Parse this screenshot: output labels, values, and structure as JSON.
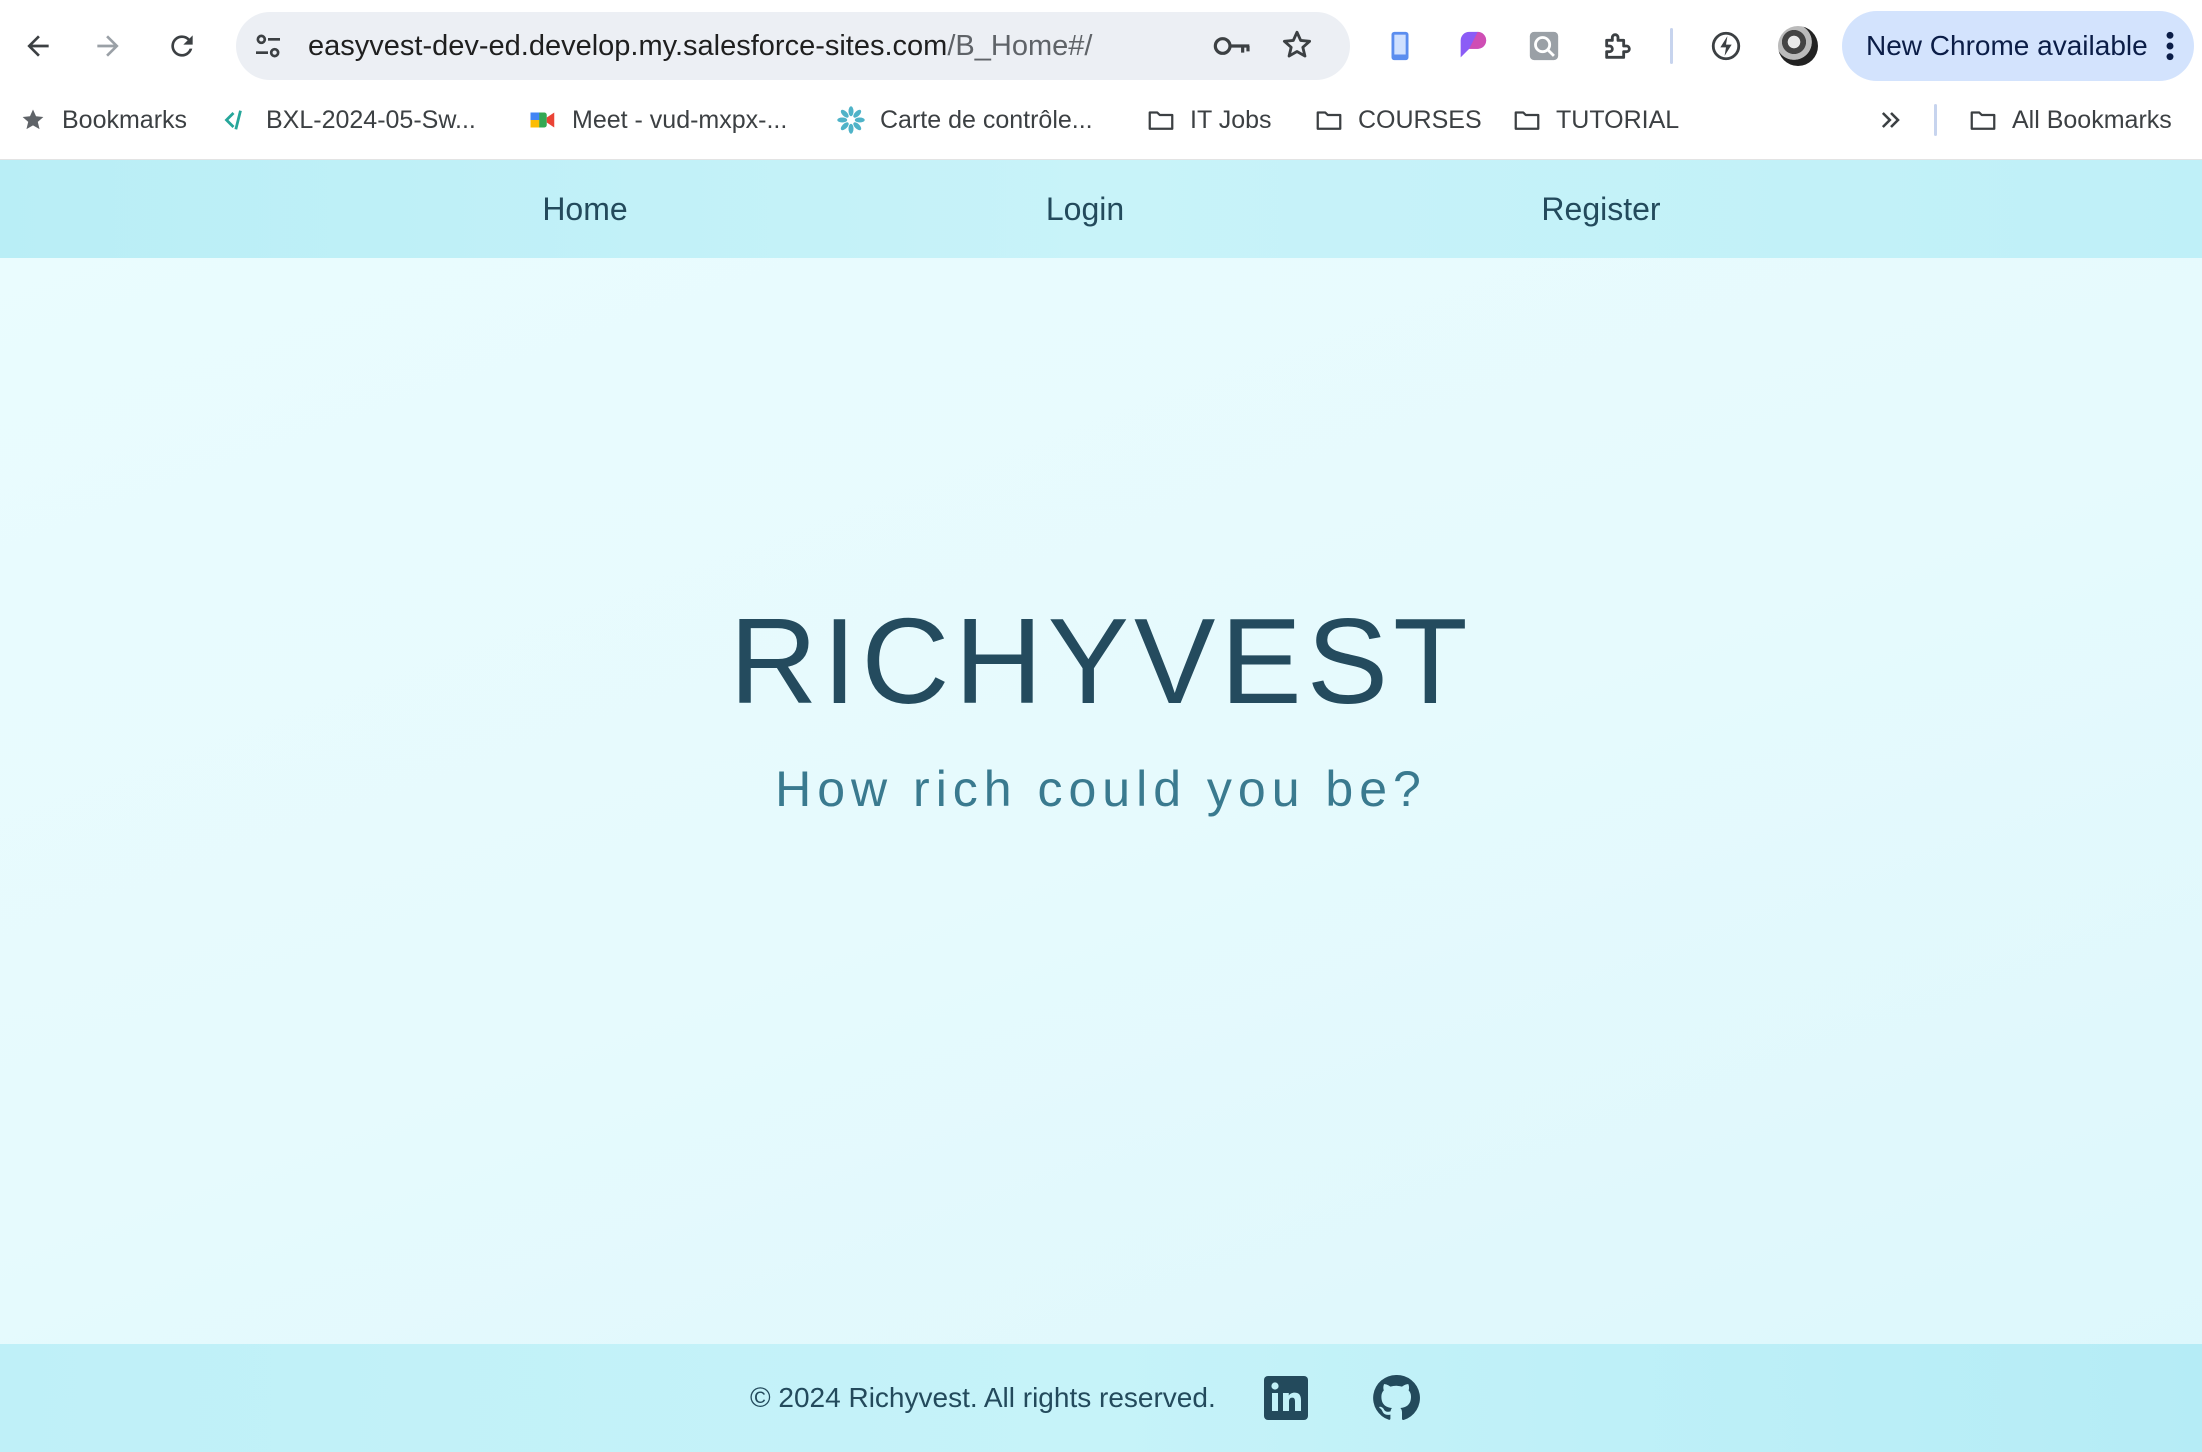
{
  "browser": {
    "url_host": "easyvest-dev-ed.develop.my.salesforce-sites.com",
    "url_path": "/B_Home#/",
    "update_button_label": "New Chrome available",
    "icons": {
      "back": "arrow-left-icon",
      "forward": "arrow-right-icon",
      "reload": "reload-icon",
      "site_info": "tune-icon",
      "passwords": "key-icon",
      "bookmark": "star-icon",
      "extensions": [
        "phone-extension-icon",
        "purple-extension-icon",
        "search-extension-icon",
        "puzzle-icon",
        "performance-icon"
      ],
      "menu": "kebab-menu-icon"
    },
    "accent_color": "#d3e3fd"
  },
  "bookmarks": {
    "items": [
      {
        "label": "Bookmarks",
        "icon": "star-icon"
      },
      {
        "label": "BXL-2024-05-Sw...",
        "icon": "code-icon"
      },
      {
        "label": "Meet - vud-mxpx-...",
        "icon": "meet-icon"
      },
      {
        "label": "Carte de contrôle...",
        "icon": "flower-icon"
      },
      {
        "label": "IT Jobs",
        "icon": "folder-icon"
      },
      {
        "label": "COURSES",
        "icon": "folder-icon"
      },
      {
        "label": "TUTORIAL",
        "icon": "folder-icon"
      }
    ],
    "overflow_icon": "chevron-double-right-icon",
    "all_bookmarks": "All Bookmarks"
  },
  "site": {
    "nav": [
      {
        "label": "Home"
      },
      {
        "label": "Login"
      },
      {
        "label": "Register"
      }
    ],
    "hero_title": "RICHYVEST",
    "hero_subtitle": "How rich could you be?",
    "footer_text": "© 2024 Richyvest. All rights reserved.",
    "social_icons": [
      "linkedin-icon",
      "github-icon"
    ],
    "colors": {
      "primary_text": "#244b5e",
      "subtitle_text": "#3a7a8f",
      "nav_background": "#c2f1f8",
      "page_background": "#e6fafd"
    }
  }
}
